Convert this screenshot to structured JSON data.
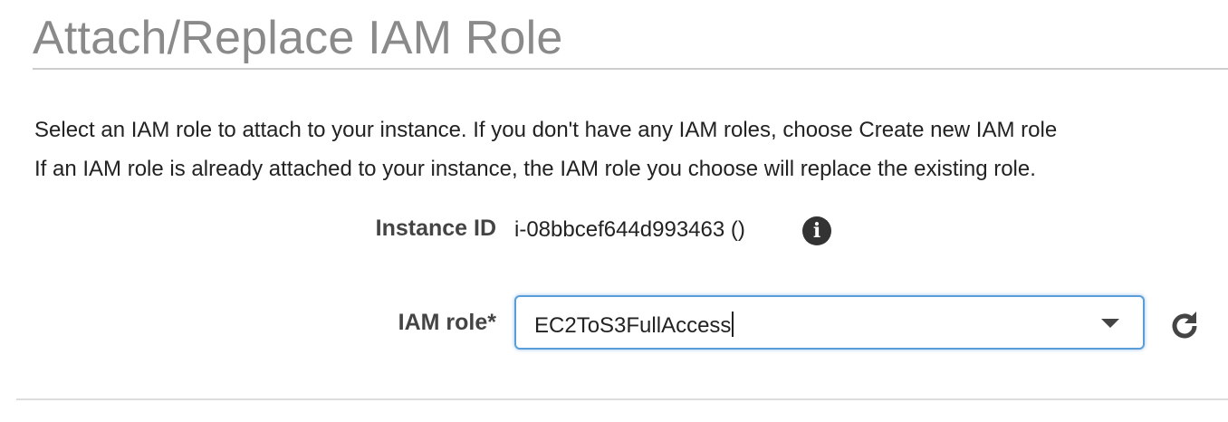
{
  "dialog": {
    "title": "Attach/Replace IAM Role",
    "description_line1": "Select an IAM role to attach to your instance. If you don't have any IAM roles, choose Create new IAM role",
    "description_line2": "If an IAM role is already attached to your instance, the IAM role you choose will replace the existing role."
  },
  "form": {
    "instance_id_label": "Instance ID",
    "instance_id_value": "i-08bbcef644d993463 ()",
    "info_icon_glyph": "i",
    "iam_role_label": "IAM role*",
    "iam_role_value": "EC2ToS3FullAccess"
  },
  "icons": {
    "info": "info-icon",
    "dropdown": "chevron-down-icon",
    "refresh": "refresh-icon"
  },
  "colors": {
    "focus_border": "#5b9dd9",
    "title": "#8a8a8a"
  }
}
